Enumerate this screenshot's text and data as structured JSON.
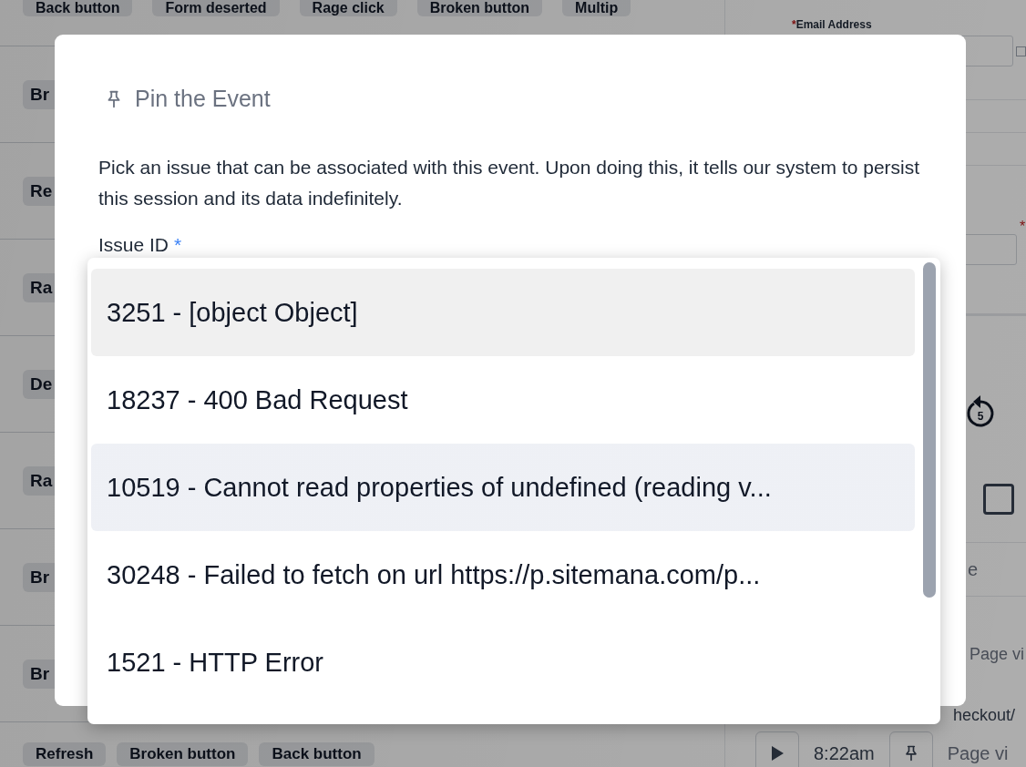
{
  "background": {
    "top_tags": [
      "Back button",
      "Form deserted",
      "Rage click",
      "Broken button",
      "Multip"
    ],
    "event_tags": [
      "Br",
      "Re",
      "Ra",
      "De",
      "Ra",
      "Br",
      "Br"
    ],
    "bottom_tags": [
      "Refresh",
      "Broken button",
      "Back button"
    ],
    "email_field": {
      "label": "Email Address",
      "required_mark": "*"
    },
    "small_checkbox": {
      "checked": false
    },
    "second_field": {
      "required_mark": "*"
    },
    "replay": {
      "seconds": "5"
    },
    "checkbox": {
      "checked": false
    },
    "text_field": {
      "value": "e"
    },
    "event_lines": [
      "Page vi",
      "heckout/"
    ],
    "current_event": {
      "time": "8:22am",
      "text": "Page vi"
    }
  },
  "modal": {
    "title": "Pin the Event",
    "description": "Pick an issue that can be associated with this event. Upon doing this, it tells our system to persist this session and its data indefinitely.",
    "field_label": "Issue ID",
    "required_mark": "*",
    "options": [
      {
        "label": "3251 - [object Object]",
        "selected": true,
        "hovered": false
      },
      {
        "label": "18237 - 400 Bad Request",
        "selected": false,
        "hovered": false
      },
      {
        "label": "10519 - Cannot read properties of undefined (reading v...",
        "selected": false,
        "hovered": true
      },
      {
        "label": "30248 - Failed to fetch on url https://p.sitemana.com/p...",
        "selected": false,
        "hovered": false
      },
      {
        "label": "1521 - HTTP Error",
        "selected": false,
        "hovered": false
      }
    ]
  }
}
